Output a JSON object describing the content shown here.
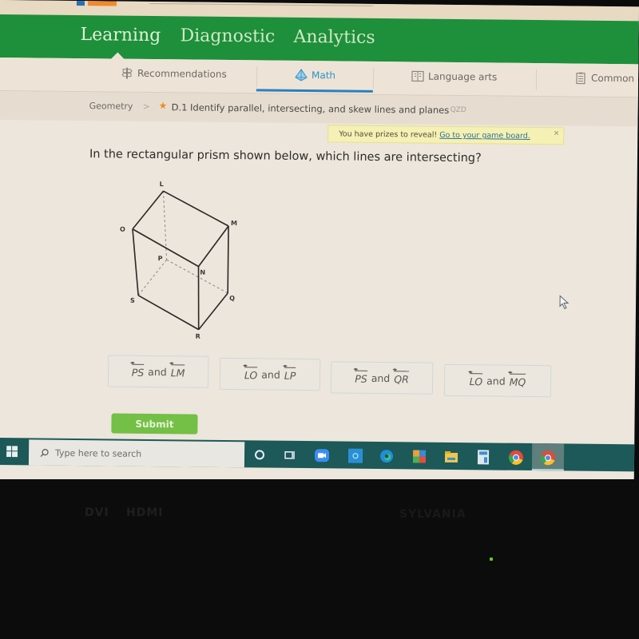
{
  "header": {
    "nav_tabs": [
      {
        "label": "Learning",
        "active": true
      },
      {
        "label": "Diagnostic",
        "active": false
      },
      {
        "label": "Analytics",
        "active": false
      }
    ]
  },
  "subnav": {
    "items": [
      {
        "label": "Recommendations",
        "icon": "signpost-icon",
        "active": false
      },
      {
        "label": "Math",
        "icon": "pyramid-icon",
        "active": true
      },
      {
        "label": "Language arts",
        "icon": "book-icon",
        "active": false
      },
      {
        "label": "Common",
        "icon": "clipboard-icon",
        "active": false
      }
    ],
    "active_color": "#2b7fc0"
  },
  "breadcrumb": {
    "subject": "Geometry",
    "separator": ">",
    "star": "★",
    "skill": "D.1 Identify parallel, intersecting, and skew lines and planes",
    "code": "QZD"
  },
  "prize_banner": {
    "text": "You have prizes to reveal! ",
    "link": "Go to your game board.",
    "close": "×"
  },
  "question": {
    "prompt": "In the rectangular prism shown below, which lines are intersecting?",
    "figure": {
      "type": "rectangular-prism",
      "vertices": [
        "L",
        "M",
        "N",
        "O",
        "P",
        "Q",
        "R",
        "S"
      ],
      "hidden_edges": [
        "LP",
        "PQ",
        "PS"
      ]
    },
    "choices": [
      {
        "a": "PS",
        "conj": "and",
        "b": "LM"
      },
      {
        "a": "LO",
        "conj": "and",
        "b": "LP"
      },
      {
        "a": "PS",
        "conj": "and",
        "b": "QR"
      },
      {
        "a": "LO",
        "conj": "and",
        "b": "MQ"
      }
    ],
    "submit_label": "Submit"
  },
  "taskbar": {
    "search_placeholder": "Type here to search",
    "apps": [
      "cortana-icon",
      "task-view-icon",
      "zoom-icon",
      "store-icon",
      "edge-icon",
      "office-icon",
      "file-explorer-icon",
      "calculator-icon",
      "chrome-icon",
      "chrome-active-icon"
    ]
  },
  "monitor": {
    "labels": [
      "DVI",
      "HDMI"
    ],
    "brand": "SYLVANIA"
  },
  "colors": {
    "nav_green": "#1e8f3b",
    "submit_green": "#74bf45",
    "taskbar": "#1c5958",
    "star": "#f08a1e"
  }
}
